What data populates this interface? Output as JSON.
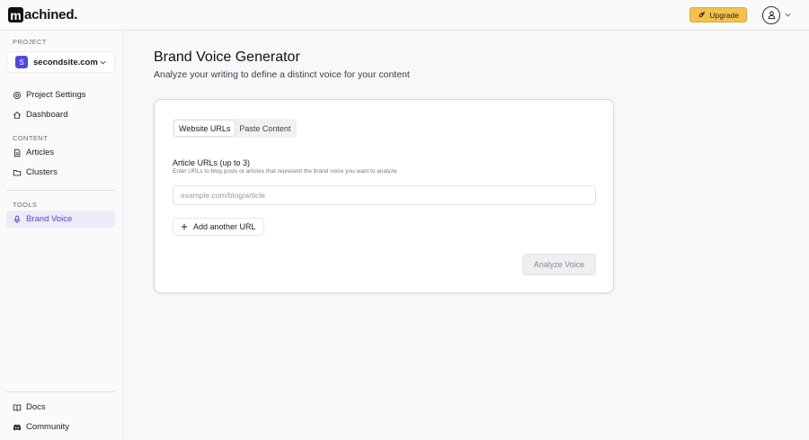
{
  "brand": {
    "logo_letter": "m",
    "logo_rest": "achined."
  },
  "header": {
    "upgrade_label": "Upgrade",
    "upgrade_icon": "rocket-icon",
    "avatar_icon": "user-icon"
  },
  "sidebar": {
    "project_section": "PROJECT",
    "project": {
      "badge": "S",
      "name": "secondsite.com"
    },
    "top_items": [
      {
        "label": "Project Settings",
        "icon": "settings-icon"
      },
      {
        "label": "Dashboard",
        "icon": "home-icon"
      }
    ],
    "content_section": "CONTENT",
    "content_items": [
      {
        "label": "Articles",
        "icon": "document-icon"
      },
      {
        "label": "Clusters",
        "icon": "folder-icon"
      }
    ],
    "tools_section": "TOOLS",
    "tools_items": [
      {
        "label": "Brand Voice",
        "icon": "microphone-icon",
        "active": true
      }
    ],
    "footer_items": [
      {
        "label": "Docs",
        "icon": "book-icon"
      },
      {
        "label": "Community",
        "icon": "discord-icon"
      }
    ]
  },
  "main": {
    "title": "Brand Voice Generator",
    "subtitle": "Analyze your writing to define a distinct voice for your content",
    "tabs": [
      {
        "label": "Website URLs",
        "active": true
      },
      {
        "label": "Paste Content",
        "active": false
      }
    ],
    "field_label": "Article URLs (up to 3)",
    "field_help": "Enter URLs to blog posts or articles that represent the brand voice you want to analyze",
    "url_placeholder": "example.com/blog/article",
    "url_value": "",
    "add_url_label": "Add another URL",
    "analyze_label": "Analyze Voice"
  },
  "colors": {
    "accent": "#4f46e5",
    "upgrade": "#f2c14e",
    "active_nav_bg": "#ecebf7"
  }
}
